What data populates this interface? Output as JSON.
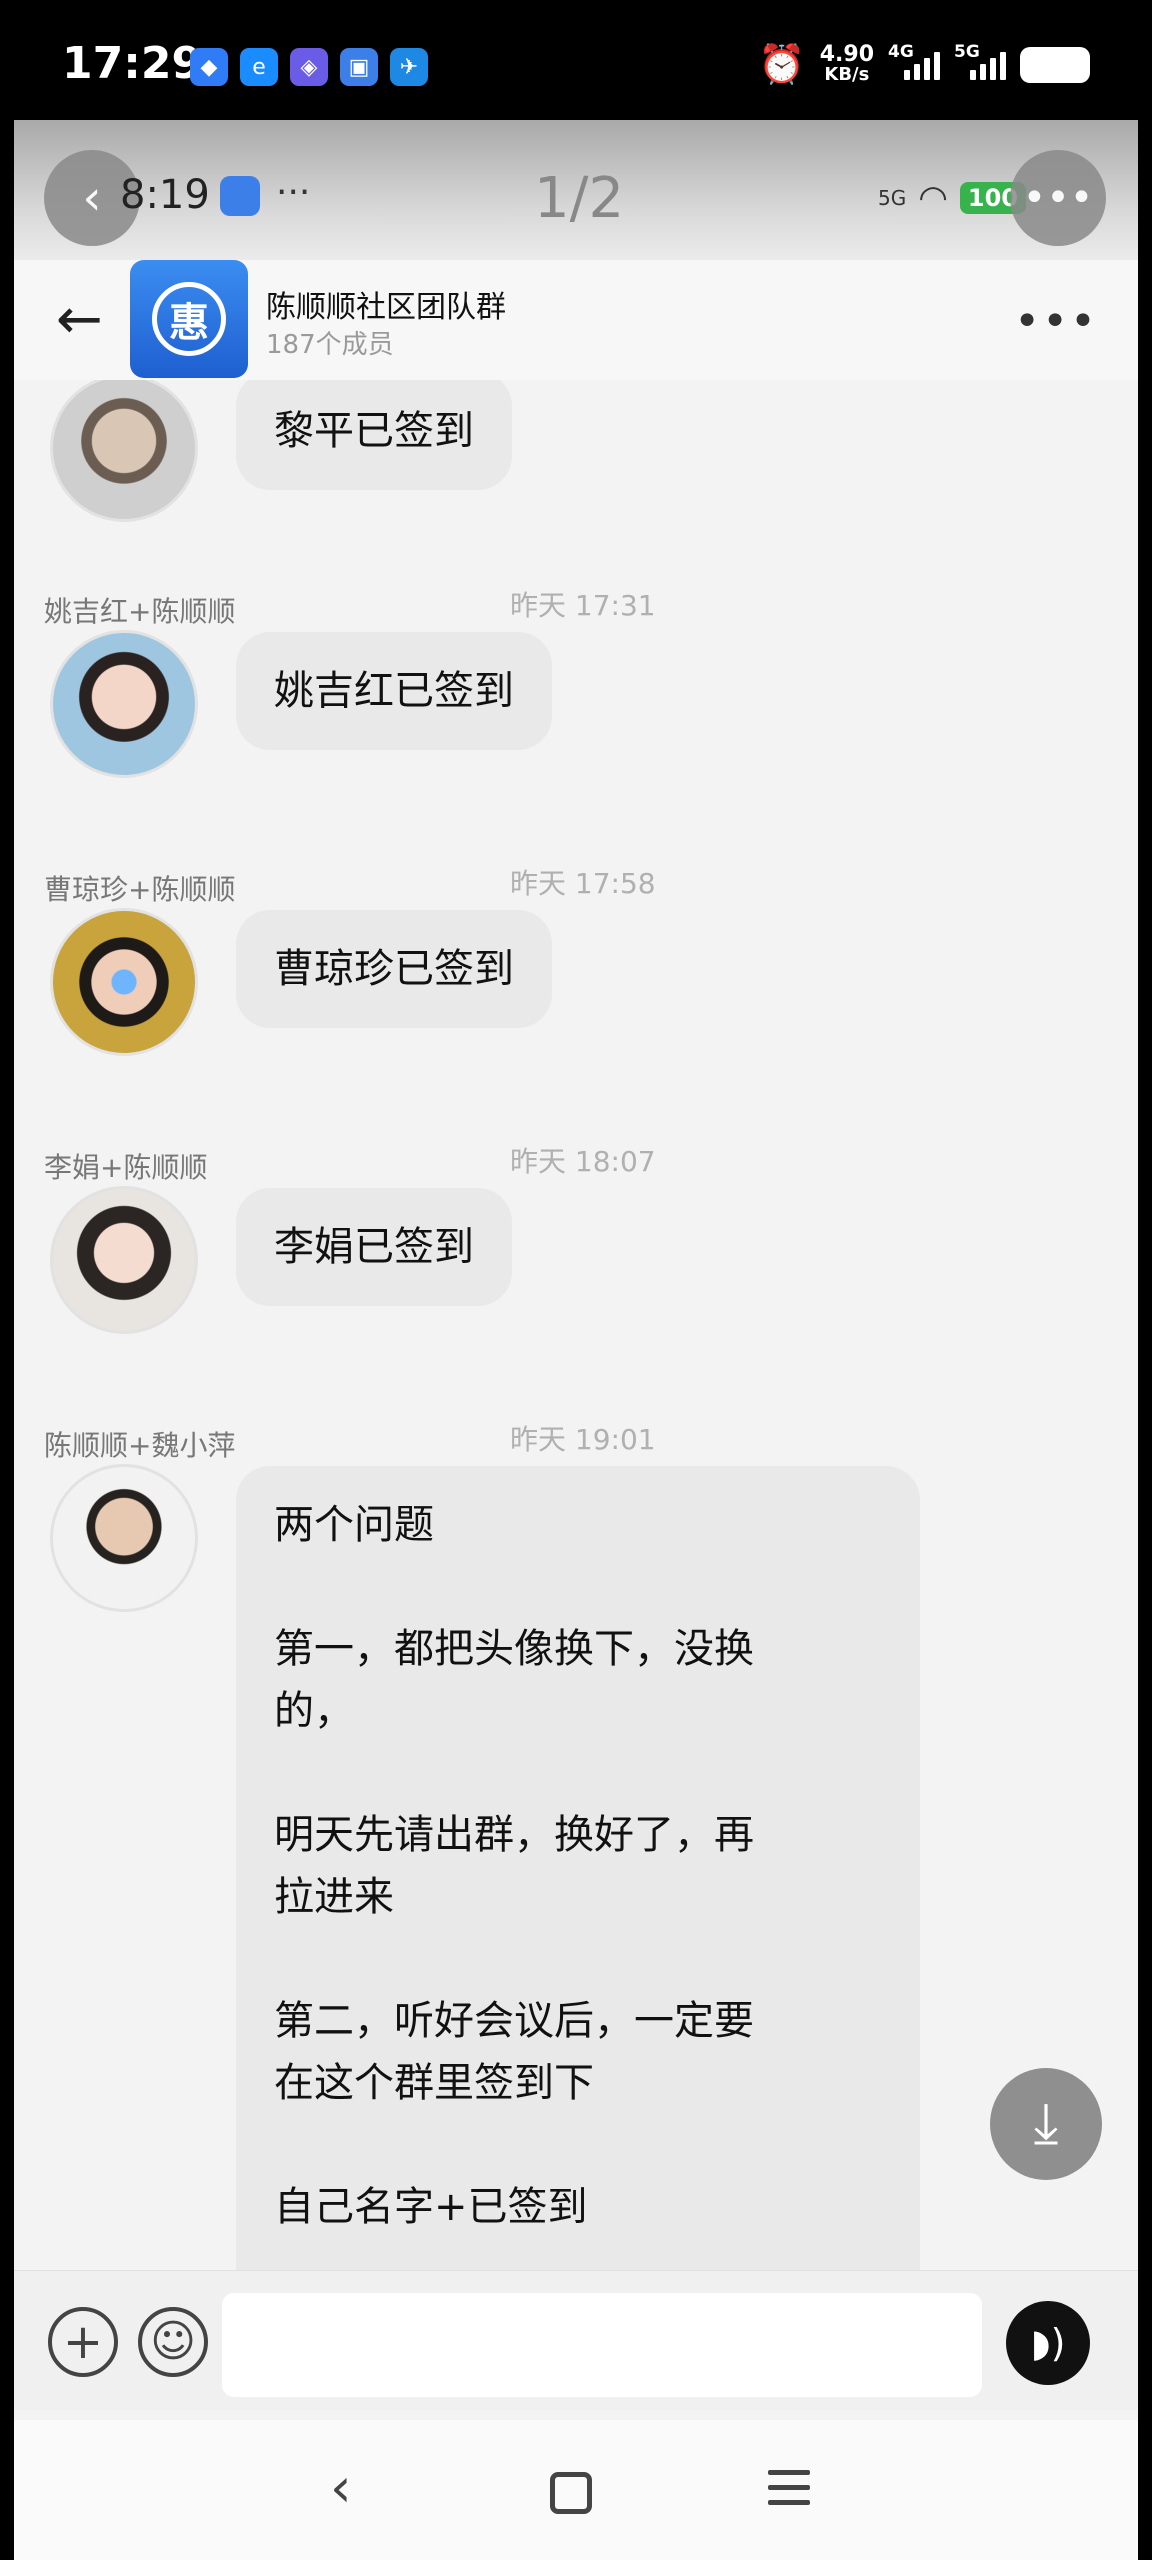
{
  "status_bar": {
    "time": "17:29",
    "net_speed": "4.90",
    "net_unit": "KB/s",
    "sim1_label": "4G",
    "sim2_label": "5G"
  },
  "recording_overlay": {
    "time": "8:19",
    "dots": "···",
    "page_indicator": "1/2",
    "network": "5G",
    "battery": "100"
  },
  "chat_header": {
    "avatar_glyph": "惠",
    "group_name": "陈顺顺社区团队群",
    "member_count": "187个成员"
  },
  "messages": [
    {
      "sender": "",
      "time": "",
      "text": "黎平已签到"
    },
    {
      "sender": "姚吉红+陈顺顺",
      "time": "昨天 17:31",
      "text": "姚吉红已签到"
    },
    {
      "sender": "曹琼珍+陈顺顺",
      "time": "昨天 17:58",
      "text": "曹琼珍已签到"
    },
    {
      "sender": "李娟+陈顺顺",
      "time": "昨天 18:07",
      "text": "李娟已签到"
    },
    {
      "sender": "陈顺顺+魏小萍",
      "time": "昨天 19:01",
      "text": "两个问题\n\n第一，都把头像换下，没换\n的，\n\n明天先请出群，换好了，再\n拉进来\n\n第二，听好会议后，一定要\n在这个群里签到下\n\n自己名字+已签到"
    }
  ],
  "input_bar": {
    "placeholder": ""
  }
}
